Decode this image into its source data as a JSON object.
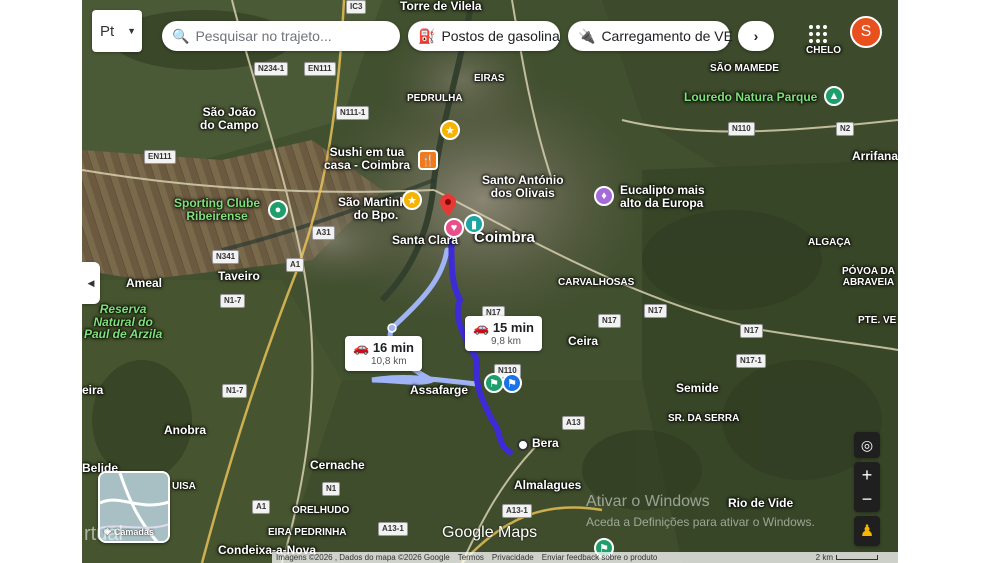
{
  "toolbar": {
    "language_button": "Pt",
    "search_placeholder": "Pesquisar no trajeto...",
    "chips": [
      "Postos de gasolina",
      "Carregamento de VE"
    ],
    "avatar_letter": "S"
  },
  "routes": [
    {
      "time": "15 min",
      "distance": "9,8 km"
    },
    {
      "time": "16 min",
      "distance": "10,8 km"
    }
  ],
  "places": {
    "torre_de_vilela": "Torre de Vilela",
    "pedrulha": "PEDRULHA",
    "eiras": "EIRAS",
    "sao_joao_do_campo": "São João\ndo Campo",
    "sushi": "Sushi em tua\ncasa - Coimbra",
    "sporting": "Sporting Clube\nRibeirense",
    "sao_martinho": "São Martinho\ndo Bpo.",
    "santa_clara": "Santa Clara",
    "coimbra": "Coimbra",
    "santo_antonio": "Santo António\ndos Olivais",
    "eucalipto": "Eucalipto mais\nalto da Europa",
    "loureido": "Louredo Natura Parque",
    "sao_mamede": "SÃO MAMEDE",
    "chelo": "CHELO",
    "arrifana": "Arrifana",
    "algaca": "ALGAÇA",
    "povoa": "PÓVOA DA\nABRAVEIA",
    "pte_ve": "PTE. VE",
    "carvalhosas": "CARVALHOSAS",
    "ceira": "Ceira",
    "semide": "Semide",
    "sr_da_serra": "SR. DA SERRA",
    "ameal": "Ameal",
    "taveiro": "Taveiro",
    "reserva": "Reserva\nNatural do\nPaul de Arzila",
    "assafarge": "Assafarge",
    "bera": "Bera",
    "eira": "eira",
    "anobra": "Anobra",
    "cernache": "Cernache",
    "belide": "Belide",
    "almalagues": "Almalagues",
    "rio_de_vide": "Rio de Vide",
    "orelhudo": "ORELHUDO",
    "eira_pedrinha": "EIRA PEDRINHA",
    "condeixa": "Condeixa-a-Nova",
    "uisa": "UISA",
    "irtual": "rtual"
  },
  "road_shields": [
    "N234-1",
    "EN111",
    "N111-1",
    "EN111",
    "N341",
    "A31",
    "A1",
    "N1-7",
    "N1-7",
    "N17",
    "N17",
    "N17",
    "N17",
    "N110",
    "N17-1",
    "N110",
    "N2",
    "A13",
    "A13-1",
    "A13-1",
    "N1",
    "A1",
    "IC3"
  ],
  "watermark": {
    "line1": "Ativar o Windows",
    "line2": "Aceda a Definições para ativar o Windows."
  },
  "layers_label": "Camadas",
  "google_logo": "Google Maps",
  "footer": {
    "imagery": "Imagens ©2026 , Dados do mapa ©2026 Google",
    "terms": "Termos",
    "privacy": "Privacidade",
    "feedback": "Enviar feedback sobre o produto",
    "scale": "2 km"
  },
  "colors": {
    "route_active": "#3d2bd6",
    "route_alt": "#9fb3f5",
    "destination_pin": "#e53935",
    "avatar": "#e8501d"
  }
}
